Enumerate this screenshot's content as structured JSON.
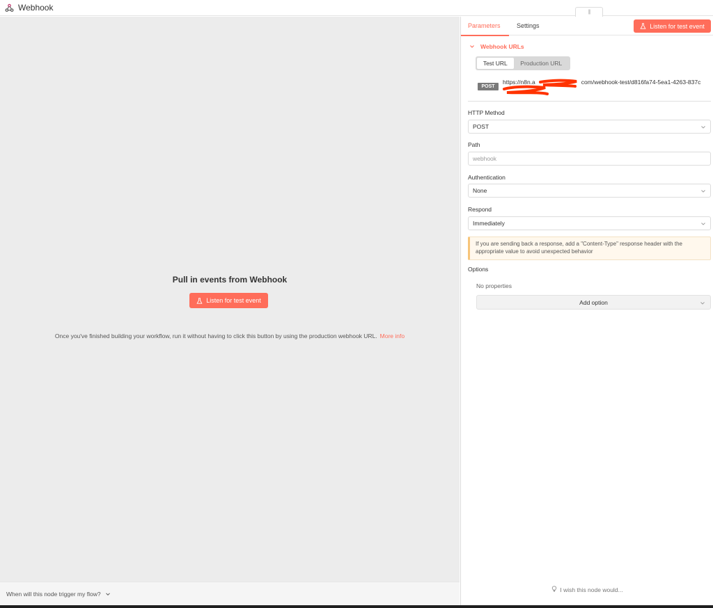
{
  "header": {
    "title": "Webhook",
    "icon": "webhook-icon",
    "drag_handle_glyph": "|||"
  },
  "left": {
    "title": "Pull in events from Webhook",
    "cta_label": "Listen for test event",
    "note": "Once you've finished building your workflow, run it without having to click this button by using the production webhook URL.",
    "more_info": "More info",
    "bottom_question": "When will this node trigger my flow?"
  },
  "right": {
    "tabs": [
      {
        "label": "Parameters",
        "active": true
      },
      {
        "label": "Settings",
        "active": false
      }
    ],
    "listen_button": "Listen for test event",
    "webhook_urls": {
      "section_label": "Webhook URLs",
      "tabs": [
        "Test URL",
        "Production URL"
      ],
      "method_badge": "POST",
      "url_visible": "https://n8n.a",
      "url_rest": "com/webhook-test/d816fa74-5ea1-4263-837c"
    },
    "fields": {
      "http_method": {
        "label": "HTTP Method",
        "value": "POST"
      },
      "path": {
        "label": "Path",
        "placeholder": "webhook"
      },
      "authentication": {
        "label": "Authentication",
        "value": "None"
      },
      "respond": {
        "label": "Respond",
        "value": "Immediately"
      }
    },
    "notice": "If you are sending back a response, add a \"Content-Type\" response header with the appropriate value to avoid unexpected behavior",
    "options": {
      "label": "Options",
      "empty": "No properties",
      "add_label": "Add option"
    },
    "wish": "I wish this node would..."
  },
  "colors": {
    "accent": "#ff6d5a",
    "redaction": "#ff3300",
    "canvas": "#ececec"
  }
}
